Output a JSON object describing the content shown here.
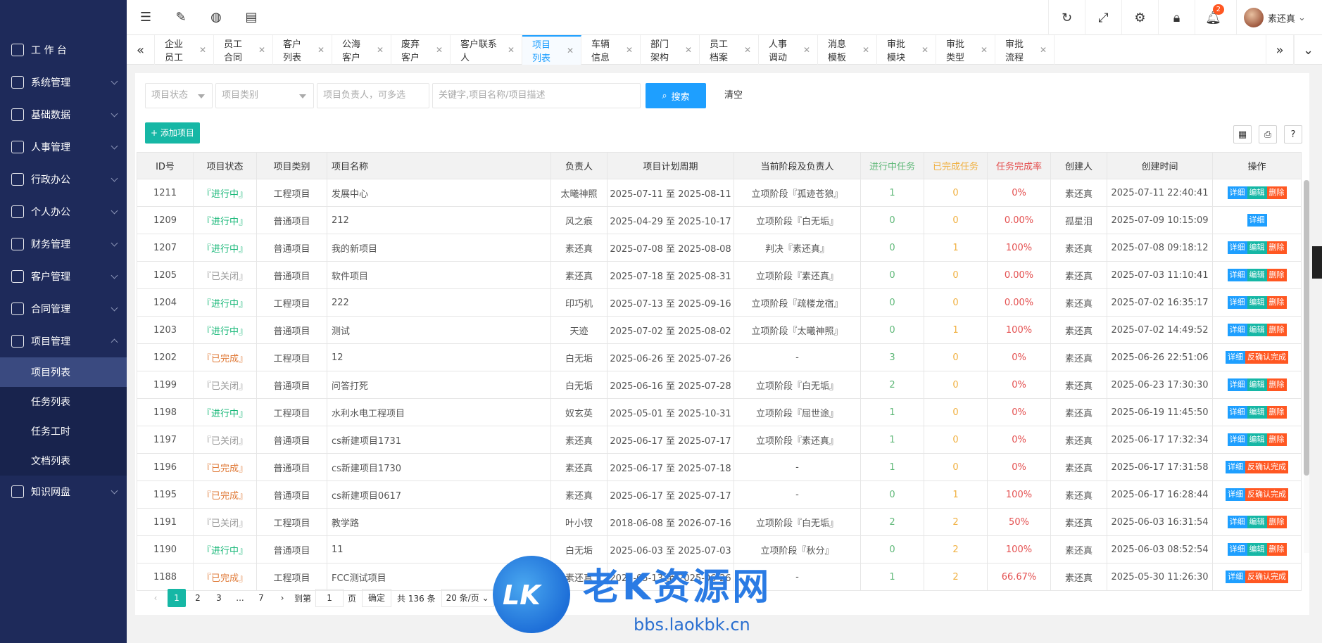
{
  "sidebar": {
    "top": {
      "label": "工 作 台"
    },
    "items": [
      {
        "label": "系统管理"
      },
      {
        "label": "基础数据"
      },
      {
        "label": "人事管理"
      },
      {
        "label": "行政办公"
      },
      {
        "label": "个人办公"
      },
      {
        "label": "财务管理"
      },
      {
        "label": "客户管理"
      },
      {
        "label": "合同管理"
      },
      {
        "label": "项目管理"
      }
    ],
    "sub": [
      {
        "label": "项目列表"
      },
      {
        "label": "任务列表"
      },
      {
        "label": "任务工时"
      },
      {
        "label": "文档列表"
      }
    ],
    "last": {
      "label": "知识网盘"
    }
  },
  "topbar": {
    "notify_count": "2",
    "user_name": "素还真"
  },
  "tabs": [
    {
      "label": "企业员工"
    },
    {
      "label": "员工合同"
    },
    {
      "label": "客户列表"
    },
    {
      "label": "公海客户"
    },
    {
      "label": "废弃客户"
    },
    {
      "label": "客户联系人"
    },
    {
      "label": "项目列表"
    },
    {
      "label": "车辆信息"
    },
    {
      "label": "部门架构"
    },
    {
      "label": "员工档案"
    },
    {
      "label": "人事调动"
    },
    {
      "label": "消息模板"
    },
    {
      "label": "审批模块"
    },
    {
      "label": "审批类型"
    },
    {
      "label": "审批流程"
    }
  ],
  "filters": {
    "status_placeholder": "项目状态",
    "category_placeholder": "项目类别",
    "owner_placeholder": "项目负责人，可多选",
    "keyword_placeholder": "关键字,项目名称/项目描述",
    "search_label": "搜索",
    "clear_label": "清空"
  },
  "toolbar": {
    "add_label": "+ 添加项目"
  },
  "table": {
    "headers": [
      "ID号",
      "项目状态",
      "项目类别",
      "项目名称",
      "负责人",
      "项目计划周期",
      "当前阶段及负责人",
      "进行中任务",
      "已完成任务",
      "任务完成率",
      "创建人",
      "创建时间",
      "操作"
    ],
    "rows": [
      {
        "id": "1211",
        "status": "『进行中』",
        "category": "工程项目",
        "name": "发展中心",
        "owner": "太曦神照",
        "period": "2025-07-11 至 2025-08-11",
        "stage": "立项阶段『孤迹苍狼』",
        "doing": "1",
        "done": "0",
        "rate": "0%",
        "creator": "素还真",
        "created": "2025-07-11 22:40:41",
        "ops": [
          "详细",
          "编辑",
          "删除"
        ]
      },
      {
        "id": "1209",
        "status": "『进行中』",
        "category": "普通项目",
        "name": "212",
        "owner": "风之痕",
        "period": "2025-04-29 至 2025-10-17",
        "stage": "立项阶段『白无垢』",
        "doing": "0",
        "done": "0",
        "rate": "0.00%",
        "creator": "孤星泪",
        "created": "2025-07-09 10:15:09",
        "ops": [
          "详细"
        ]
      },
      {
        "id": "1207",
        "status": "『进行中』",
        "category": "普通项目",
        "name": "我的新项目",
        "owner": "素还真",
        "period": "2025-07-08 至 2025-08-08",
        "stage": "判决『素还真』",
        "doing": "0",
        "done": "1",
        "rate": "100%",
        "creator": "素还真",
        "created": "2025-07-08 09:18:12",
        "ops": [
          "详细",
          "编辑",
          "删除"
        ]
      },
      {
        "id": "1205",
        "status": "『已关闭』",
        "category": "普通项目",
        "name": "软件项目",
        "owner": "素还真",
        "period": "2025-07-18 至 2025-08-31",
        "stage": "立项阶段『素还真』",
        "doing": "0",
        "done": "0",
        "rate": "0.00%",
        "creator": "素还真",
        "created": "2025-07-03 11:10:41",
        "ops": [
          "详细",
          "编辑",
          "删除"
        ]
      },
      {
        "id": "1204",
        "status": "『进行中』",
        "category": "工程项目",
        "name": "222",
        "owner": "印巧机",
        "period": "2025-07-13 至 2025-09-16",
        "stage": "立项阶段『疏楼龙宿』",
        "doing": "0",
        "done": "0",
        "rate": "0.00%",
        "creator": "素还真",
        "created": "2025-07-02 16:35:17",
        "ops": [
          "详细",
          "编辑",
          "删除"
        ]
      },
      {
        "id": "1203",
        "status": "『进行中』",
        "category": "普通项目",
        "name": "测试",
        "owner": "天迹",
        "period": "2025-07-02 至 2025-08-02",
        "stage": "立项阶段『太曦神照』",
        "doing": "0",
        "done": "1",
        "rate": "100%",
        "creator": "素还真",
        "created": "2025-07-02 14:49:52",
        "ops": [
          "详细",
          "编辑",
          "删除"
        ]
      },
      {
        "id": "1202",
        "status": "『已完成』",
        "category": "工程项目",
        "name": "12",
        "owner": "白无垢",
        "period": "2025-06-26 至 2025-07-26",
        "stage": "-",
        "doing": "3",
        "done": "0",
        "rate": "0%",
        "creator": "素还真",
        "created": "2025-06-26 22:51:06",
        "ops": [
          "详细",
          "反确认完成"
        ]
      },
      {
        "id": "1199",
        "status": "『已关闭』",
        "category": "普通项目",
        "name": "问答打死",
        "owner": "白无垢",
        "period": "2025-06-16 至 2025-07-28",
        "stage": "立项阶段『白无垢』",
        "doing": "2",
        "done": "0",
        "rate": "0%",
        "creator": "素还真",
        "created": "2025-06-23 17:30:30",
        "ops": [
          "详细",
          "编辑",
          "删除"
        ]
      },
      {
        "id": "1198",
        "status": "『进行中』",
        "category": "工程项目",
        "name": "水利水电工程项目",
        "owner": "奴玄英",
        "period": "2025-05-01 至 2025-10-31",
        "stage": "立项阶段『屈世途』",
        "doing": "1",
        "done": "0",
        "rate": "0%",
        "creator": "素还真",
        "created": "2025-06-19 11:45:50",
        "ops": [
          "详细",
          "编辑",
          "删除"
        ]
      },
      {
        "id": "1197",
        "status": "『已关闭』",
        "category": "普通项目",
        "name": "cs新建项目1731",
        "owner": "素还真",
        "period": "2025-06-17 至 2025-07-17",
        "stage": "立项阶段『素还真』",
        "doing": "1",
        "done": "0",
        "rate": "0%",
        "creator": "素还真",
        "created": "2025-06-17 17:32:34",
        "ops": [
          "详细",
          "编辑",
          "删除"
        ]
      },
      {
        "id": "1196",
        "status": "『已完成』",
        "category": "普通项目",
        "name": "cs新建项目1730",
        "owner": "素还真",
        "period": "2025-06-17 至 2025-07-18",
        "stage": "-",
        "doing": "1",
        "done": "0",
        "rate": "0%",
        "creator": "素还真",
        "created": "2025-06-17 17:31:58",
        "ops": [
          "详细",
          "反确认完成"
        ]
      },
      {
        "id": "1195",
        "status": "『已完成』",
        "category": "普通项目",
        "name": "cs新建项目0617",
        "owner": "素还真",
        "period": "2025-06-17 至 2025-07-17",
        "stage": "-",
        "doing": "0",
        "done": "1",
        "rate": "100%",
        "creator": "素还真",
        "created": "2025-06-17 16:28:44",
        "ops": [
          "详细",
          "反确认完成"
        ]
      },
      {
        "id": "1191",
        "status": "『已关闭』",
        "category": "工程项目",
        "name": "教学路",
        "owner": "叶小钗",
        "period": "2018-06-08 至 2026-07-16",
        "stage": "立项阶段『白无垢』",
        "doing": "2",
        "done": "2",
        "rate": "50%",
        "creator": "素还真",
        "created": "2025-06-03 16:31:54",
        "ops": [
          "详细",
          "编辑",
          "删除"
        ]
      },
      {
        "id": "1190",
        "status": "『进行中』",
        "category": "普通项目",
        "name": "11",
        "owner": "白无垢",
        "period": "2025-06-03 至 2025-07-03",
        "stage": "立项阶段『秋分』",
        "doing": "0",
        "done": "2",
        "rate": "100%",
        "creator": "素还真",
        "created": "2025-06-03 08:52:54",
        "ops": [
          "详细",
          "编辑",
          "删除"
        ]
      },
      {
        "id": "1188",
        "status": "『已完成』",
        "category": "工程项目",
        "name": "FCC测试项目",
        "owner": "素还真",
        "period": "2025-05-13 至 2025-06-26",
        "stage": "-",
        "doing": "1",
        "done": "2",
        "rate": "66.67%",
        "creator": "素还真",
        "created": "2025-05-30 11:26:30",
        "ops": [
          "详细",
          "反确认完成"
        ]
      }
    ]
  },
  "pagination": {
    "pages": [
      "1",
      "2",
      "3",
      "...",
      "7"
    ],
    "goto_label": "到第",
    "goto_value": "1",
    "page_unit": "页",
    "confirm_label": "确定",
    "total": "共 136 条",
    "page_size": "20 条/页"
  },
  "watermark": {
    "logo_text": "LK",
    "title": "老K资源网",
    "url": "bbs.laokbk.cn"
  },
  "colors": {
    "sidebar_bg": "#1e2a5a",
    "accent_blue": "#1e9fff",
    "accent_teal": "#16b7a5",
    "danger": "#ff5722"
  }
}
